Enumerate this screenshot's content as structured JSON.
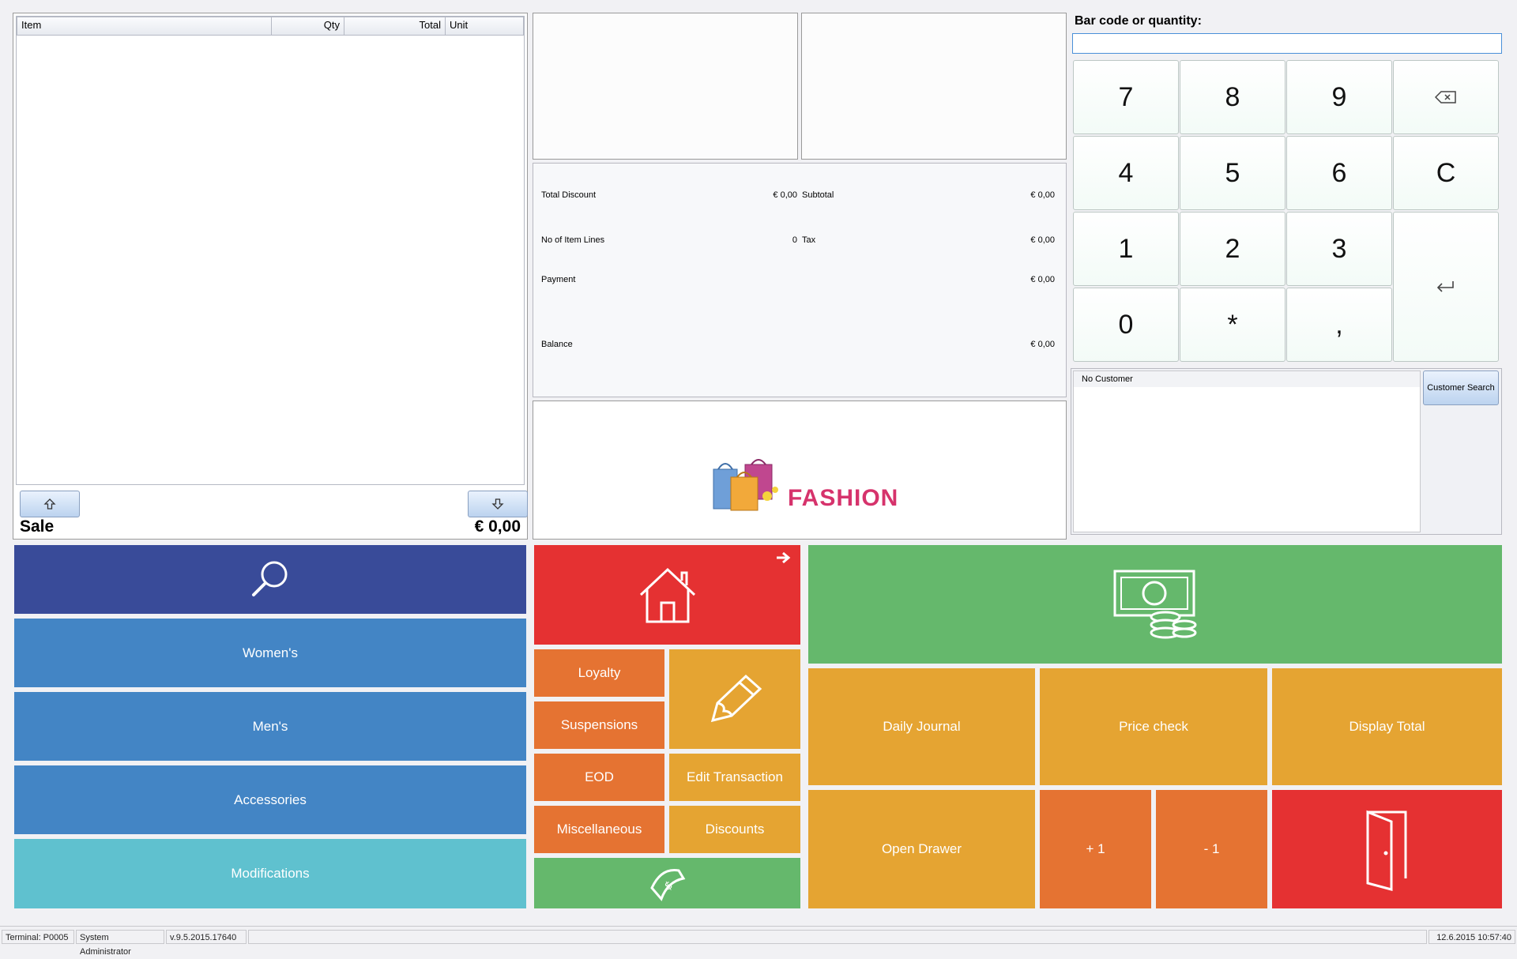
{
  "receipt": {
    "columns": [
      "Item",
      "Qty",
      "Total",
      "Unit"
    ],
    "sale_label": "Sale",
    "sale_amount": "€ 0,00"
  },
  "totals": {
    "total_discount_label": "Total Discount",
    "total_discount_value": "€ 0,00",
    "subtotal_label": "Subtotal",
    "subtotal_value": "€ 0,00",
    "item_lines_label": "No of Item Lines",
    "item_lines_value": "0",
    "tax_label": "Tax",
    "tax_value": "€ 0,00",
    "payment_label": "Payment",
    "payment_value": "€ 0,00",
    "balance_label": "Balance",
    "balance_value": "€ 0,00"
  },
  "logo": {
    "text": "FASHION",
    "icon": "shopping-bags-icon"
  },
  "keypad": {
    "input_label": "Bar code or quantity:",
    "input_value": "",
    "keys": {
      "k7": "7",
      "k8": "8",
      "k9": "9",
      "k4": "4",
      "k5": "5",
      "k6": "6",
      "clear": "C",
      "k1": "1",
      "k2": "2",
      "k3": "3",
      "k0": "0",
      "star": "*",
      "comma": ","
    },
    "backspace_icon": "backspace-icon",
    "enter_icon": "enter-icon"
  },
  "customer": {
    "header": "No Customer",
    "search_button": "Customer Search"
  },
  "tiles": {
    "search_icon": "search-icon",
    "womens": "Women's",
    "mens": "Men's",
    "accessories": "Accessories",
    "modifications": "Modifications",
    "home_icon": "home-icon",
    "loyalty": "Loyalty",
    "suspensions": "Suspensions",
    "eod": "EOD",
    "miscellaneous": "Miscellaneous",
    "edit_transaction": "Edit Transaction",
    "discounts": "Discounts",
    "pencil_icon": "pencil-icon",
    "cash_icon": "cash-icon",
    "payment_icon": "money-coins-icon",
    "daily_journal": "Daily Journal",
    "price_check": "Price check",
    "display_total": "Display Total",
    "open_drawer": "Open Drawer",
    "plus_one": "+ 1",
    "minus_one": "- 1",
    "exit_icon": "door-exit-icon"
  },
  "colors": {
    "navy": "#394b99",
    "blue": "#4385c5",
    "cyan": "#5fc1cf",
    "red": "#e53132",
    "orange": "#e57332",
    "amber": "#e5a432",
    "green": "#65b86c",
    "logo_text": "#d6336c"
  },
  "status": {
    "terminal": "Terminal: P0005",
    "user": "System Administrator",
    "version": "v.9.5.2015.17640",
    "datetime": "12.6.2015 10:57:40"
  }
}
